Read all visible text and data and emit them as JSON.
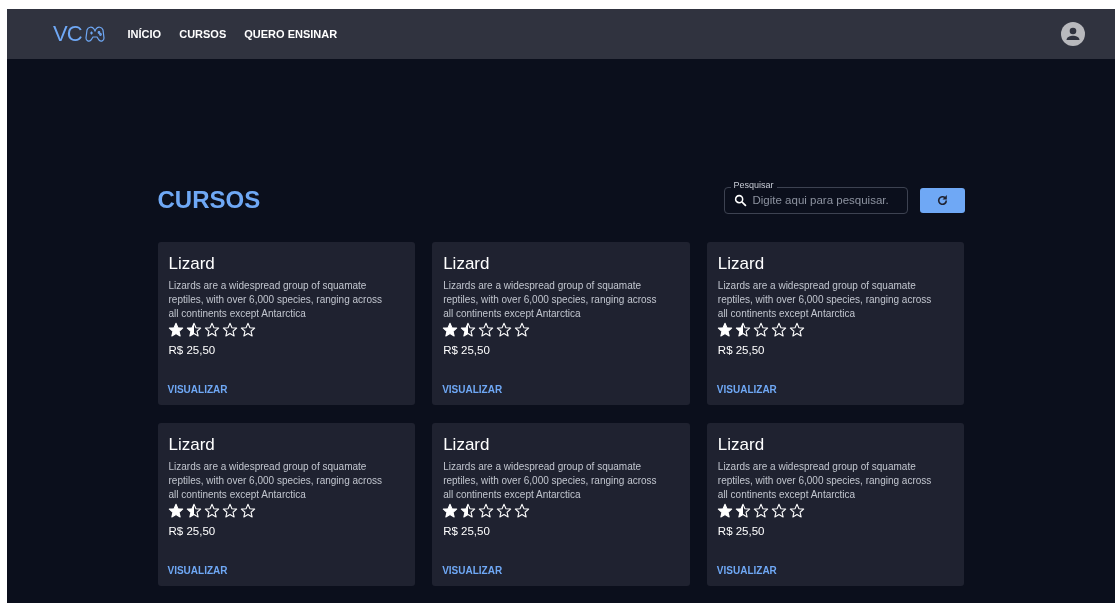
{
  "nav": {
    "logo": "VC",
    "links": [
      {
        "label": "INÍCIO"
      },
      {
        "label": "CURSOS"
      },
      {
        "label": "QUERO ENSINAR"
      }
    ]
  },
  "page_title": "CURSOS",
  "search": {
    "label": "Pesquisar",
    "placeholder": "Digite aqui para pesquisar."
  },
  "courses": [
    {
      "title": "Lizard",
      "description": "Lizards are a widespread group of squamate reptiles, with over 6,000 species, ranging across all continents except Antarctica",
      "stars": 1.5,
      "price": "R$ 25,50",
      "action": "VISUALIZAR"
    },
    {
      "title": "Lizard",
      "description": "Lizards are a widespread group of squamate reptiles, with over 6,000 species, ranging across all continents except Antarctica",
      "stars": 1.5,
      "price": "R$ 25,50",
      "action": "VISUALIZAR"
    },
    {
      "title": "Lizard",
      "description": "Lizards are a widespread group of squamate reptiles, with over 6,000 species, ranging across all continents except Antarctica",
      "stars": 1.5,
      "price": "R$ 25,50",
      "action": "VISUALIZAR"
    },
    {
      "title": "Lizard",
      "description": "Lizards are a widespread group of squamate reptiles, with over 6,000 species, ranging across all continents except Antarctica",
      "stars": 1.5,
      "price": "R$ 25,50",
      "action": "VISUALIZAR"
    },
    {
      "title": "Lizard",
      "description": "Lizards are a widespread group of squamate reptiles, with over 6,000 species, ranging across all continents except Antarctica",
      "stars": 1.5,
      "price": "R$ 25,50",
      "action": "VISUALIZAR"
    },
    {
      "title": "Lizard",
      "description": "Lizards are a widespread group of squamate reptiles, with over 6,000 species, ranging across all continents except Antarctica",
      "stars": 1.5,
      "price": "R$ 25,50",
      "action": "VISUALIZAR"
    }
  ]
}
